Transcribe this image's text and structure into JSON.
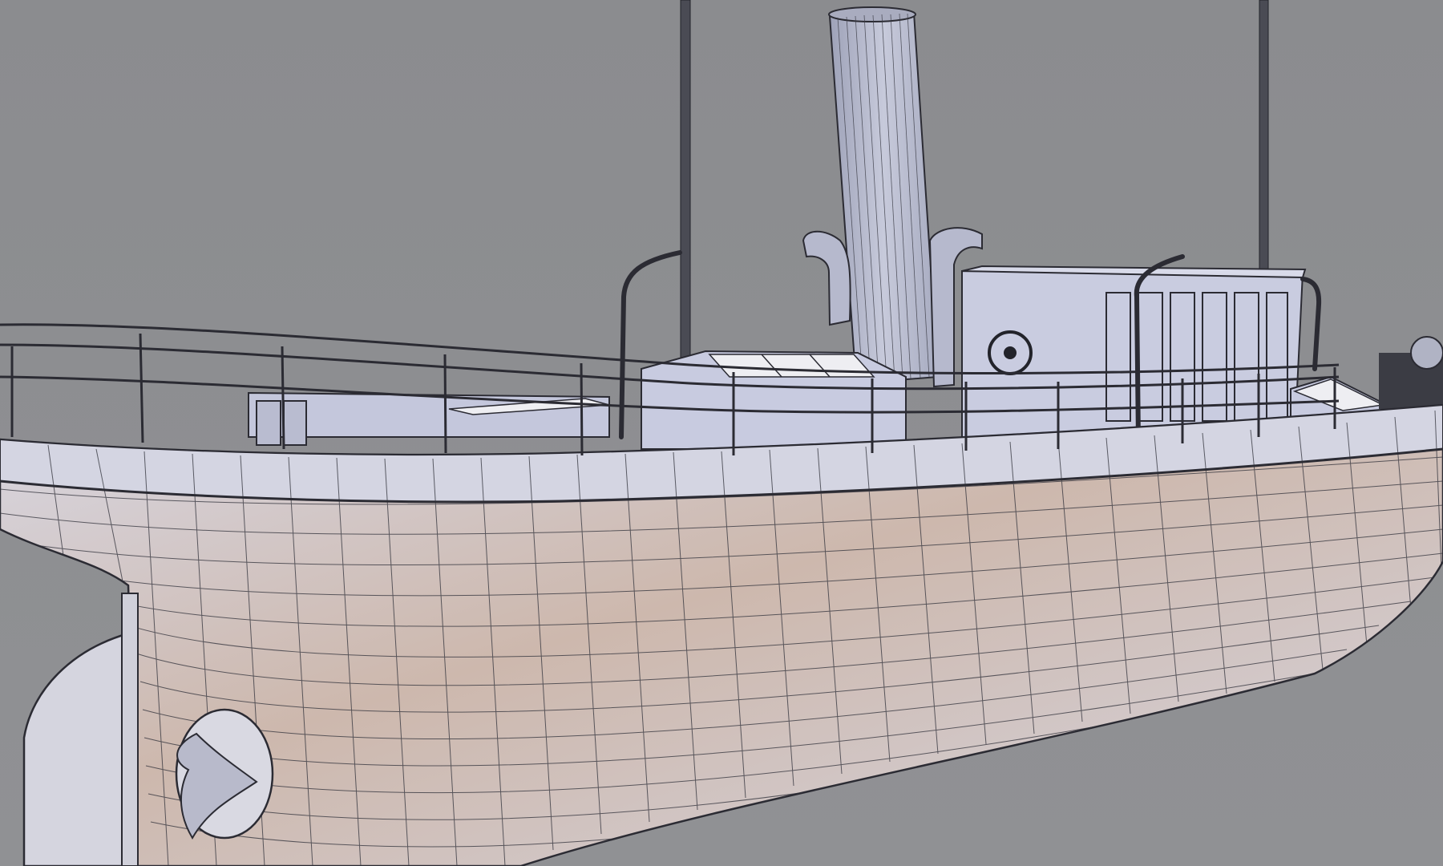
{
  "scene": {
    "kind": "3d-wireframe-render",
    "subject": "steam-ship-hull",
    "colors": {
      "background": "#8d8e91",
      "hull_light": "#d9d9e3",
      "hull_warm": "#c9b3a6",
      "superstructure": "#c8cbe0",
      "wire": "#2b2b33",
      "dark": "#3b3c44",
      "glass": "#eeeef2"
    }
  }
}
